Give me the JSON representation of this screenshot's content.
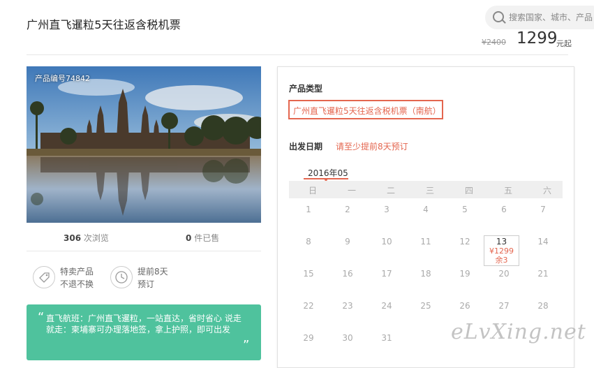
{
  "header": {
    "title": "广州直飞暹粒5天往返含税机票",
    "search_placeholder": "搜索国家、城市、产品",
    "old_price": "¥2400",
    "price": "1299",
    "price_unit": "元起"
  },
  "product": {
    "number": "产品编号74842",
    "views_count": "306",
    "views_label": "次浏览",
    "sold_count": "0",
    "sold_label": "件已售",
    "features": [
      {
        "line1": "特卖产品",
        "line2": "不退不换",
        "icon": "tag-icon"
      },
      {
        "line1": "提前8天",
        "line2": "预订",
        "icon": "clock-icon"
      }
    ],
    "quote_open": "“",
    "quote_close": "”",
    "quote": "直飞航班：广州直飞暹粒，一站直达，省时省心 说走就走：柬埔寨可办理落地签，拿上护照，即可出发"
  },
  "booking": {
    "type_label": "产品类型",
    "type_value": "广州直飞暹粒5天往返含税机票（南航）",
    "date_label": "出发日期",
    "date_note": "请至少提前8天预订",
    "month": "2016年05",
    "weekdays": [
      "日",
      "一",
      "二",
      "三",
      "四",
      "五",
      "六"
    ],
    "weeks": [
      [
        "1",
        "2",
        "3",
        "4",
        "5",
        "6",
        "7"
      ],
      [
        "8",
        "9",
        "10",
        "11",
        "12",
        "13",
        "14"
      ],
      [
        "15",
        "16",
        "17",
        "18",
        "19",
        "20",
        "21"
      ],
      [
        "22",
        "23",
        "24",
        "25",
        "26",
        "27",
        "28"
      ],
      [
        "29",
        "30",
        "31",
        "",
        "",
        "",
        ""
      ]
    ],
    "selected": {
      "day": "13",
      "price": "¥1299",
      "remaining": "余3"
    }
  },
  "watermark": "eLvXing.net",
  "colors": {
    "accent": "#e4664f",
    "quote_bg": "#4fc29d"
  }
}
